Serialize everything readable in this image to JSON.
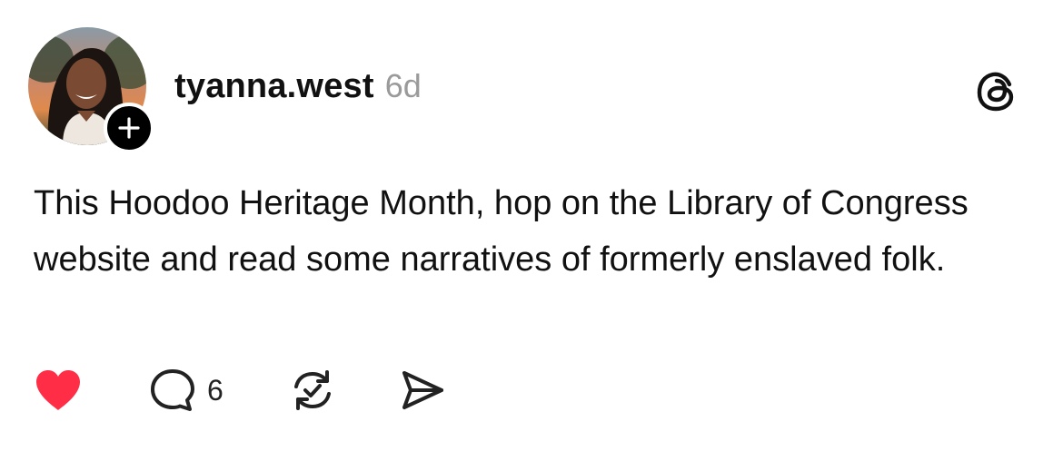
{
  "post": {
    "username": "tyanna.west",
    "timestamp": "6d",
    "text": "This Hoodoo Heritage Month, hop on the Library of Congress website and read some narratives of formerly enslaved folk.",
    "reply_count": "6",
    "liked": true
  },
  "colors": {
    "like_red": "#ff2d46",
    "text": "#111111",
    "muted": "#9a9a9a"
  },
  "icons": {
    "follow": "plus-icon",
    "logo": "threads-logo-icon",
    "like": "heart-icon",
    "reply": "comment-bubble-icon",
    "repost": "repost-icon",
    "share": "send-icon"
  }
}
